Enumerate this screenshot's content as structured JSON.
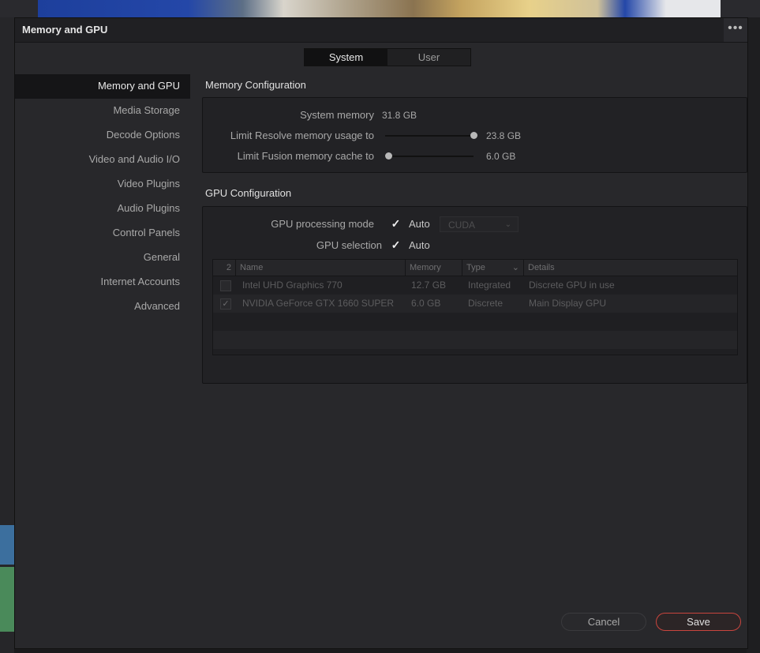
{
  "window": {
    "title": "Memory and GPU",
    "more_label": "•••"
  },
  "tabs": [
    {
      "label": "System",
      "active": true
    },
    {
      "label": "User",
      "active": false
    }
  ],
  "sidebar": {
    "items": [
      {
        "label": "Memory and GPU",
        "active": true
      },
      {
        "label": "Media Storage"
      },
      {
        "label": "Decode Options"
      },
      {
        "label": "Video and Audio I/O"
      },
      {
        "label": "Video Plugins"
      },
      {
        "label": "Audio Plugins"
      },
      {
        "label": "Control Panels"
      },
      {
        "label": "General"
      },
      {
        "label": "Internet Accounts"
      },
      {
        "label": "Advanced"
      }
    ]
  },
  "memory": {
    "section_title": "Memory Configuration",
    "system_memory_label": "System memory",
    "system_memory_value": "31.8 GB",
    "resolve_label": "Limit Resolve memory usage to",
    "resolve_value": "23.8 GB",
    "resolve_fraction": 1.0,
    "fusion_label": "Limit Fusion memory cache to",
    "fusion_value": "6.0 GB",
    "fusion_fraction": 0.0
  },
  "gpu": {
    "section_title": "GPU Configuration",
    "mode_label": "GPU processing mode",
    "mode_auto_label": "Auto",
    "mode_auto_checked": true,
    "mode_select_value": "CUDA",
    "selection_label": "GPU selection",
    "selection_auto_label": "Auto",
    "selection_auto_checked": true,
    "table": {
      "columns": [
        "2",
        "Name",
        "Memory",
        "Type",
        "Details"
      ],
      "rows": [
        {
          "checked": false,
          "name": "Intel UHD Graphics 770",
          "memory": "12.7 GB",
          "type": "Integrated",
          "details": "Discrete GPU in use"
        },
        {
          "checked": true,
          "name": "NVIDIA GeForce GTX 1660 SUPER",
          "memory": "6.0 GB",
          "type": "Discrete",
          "details": "Main Display GPU"
        }
      ]
    }
  },
  "buttons": {
    "cancel": "Cancel",
    "save": "Save"
  },
  "icons": {
    "check": "✓",
    "chevron": "⌄"
  }
}
